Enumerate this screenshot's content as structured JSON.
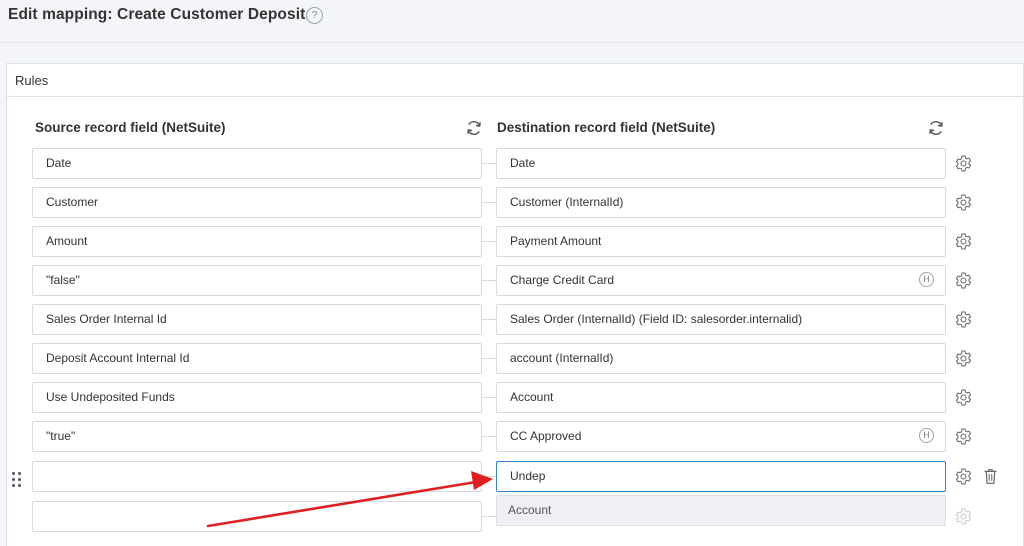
{
  "header": {
    "title": "Edit mapping: Create Customer Deposit",
    "help_icon_glyph": "?"
  },
  "panel": {
    "title": "Rules"
  },
  "columns": {
    "source_label": "Source record field (NetSuite)",
    "destination_label": "Destination record field (NetSuite)"
  },
  "rows": [
    {
      "source": "Date",
      "destination": "Date",
      "hard_coded": false
    },
    {
      "source": "Customer",
      "destination": "Customer (InternalId)",
      "hard_coded": false
    },
    {
      "source": "Amount",
      "destination": "Payment Amount",
      "hard_coded": false
    },
    {
      "source": "\"false\"",
      "destination": "Charge Credit Card",
      "hard_coded": true
    },
    {
      "source": "Sales Order Internal Id",
      "destination": "Sales Order (InternalId) (Field ID: salesorder.internalid)",
      "hard_coded": false
    },
    {
      "source": "Deposit Account Internal Id",
      "destination": "account (InternalId)",
      "hard_coded": false
    },
    {
      "source": "Use Undeposited Funds",
      "destination": "Account",
      "hard_coded": false
    },
    {
      "source": "\"true\"",
      "destination": "CC Approved",
      "hard_coded": true
    }
  ],
  "hard_coded_badge": "H",
  "editing_row": {
    "source": "",
    "destination": "Undep"
  },
  "empty_row": {
    "source": "",
    "destination": ""
  },
  "autocomplete": {
    "suggestion": "Account"
  },
  "colors": {
    "accent_border": "#2f83c9",
    "annotation_arrow": "#e02020"
  },
  "icons": {
    "help": "help-circle-icon",
    "refresh": "refresh-icon",
    "settings": "gear-icon",
    "hard_coded": "h-badge-icon",
    "delete": "trash-icon",
    "drag": "drag-handle-icon"
  }
}
